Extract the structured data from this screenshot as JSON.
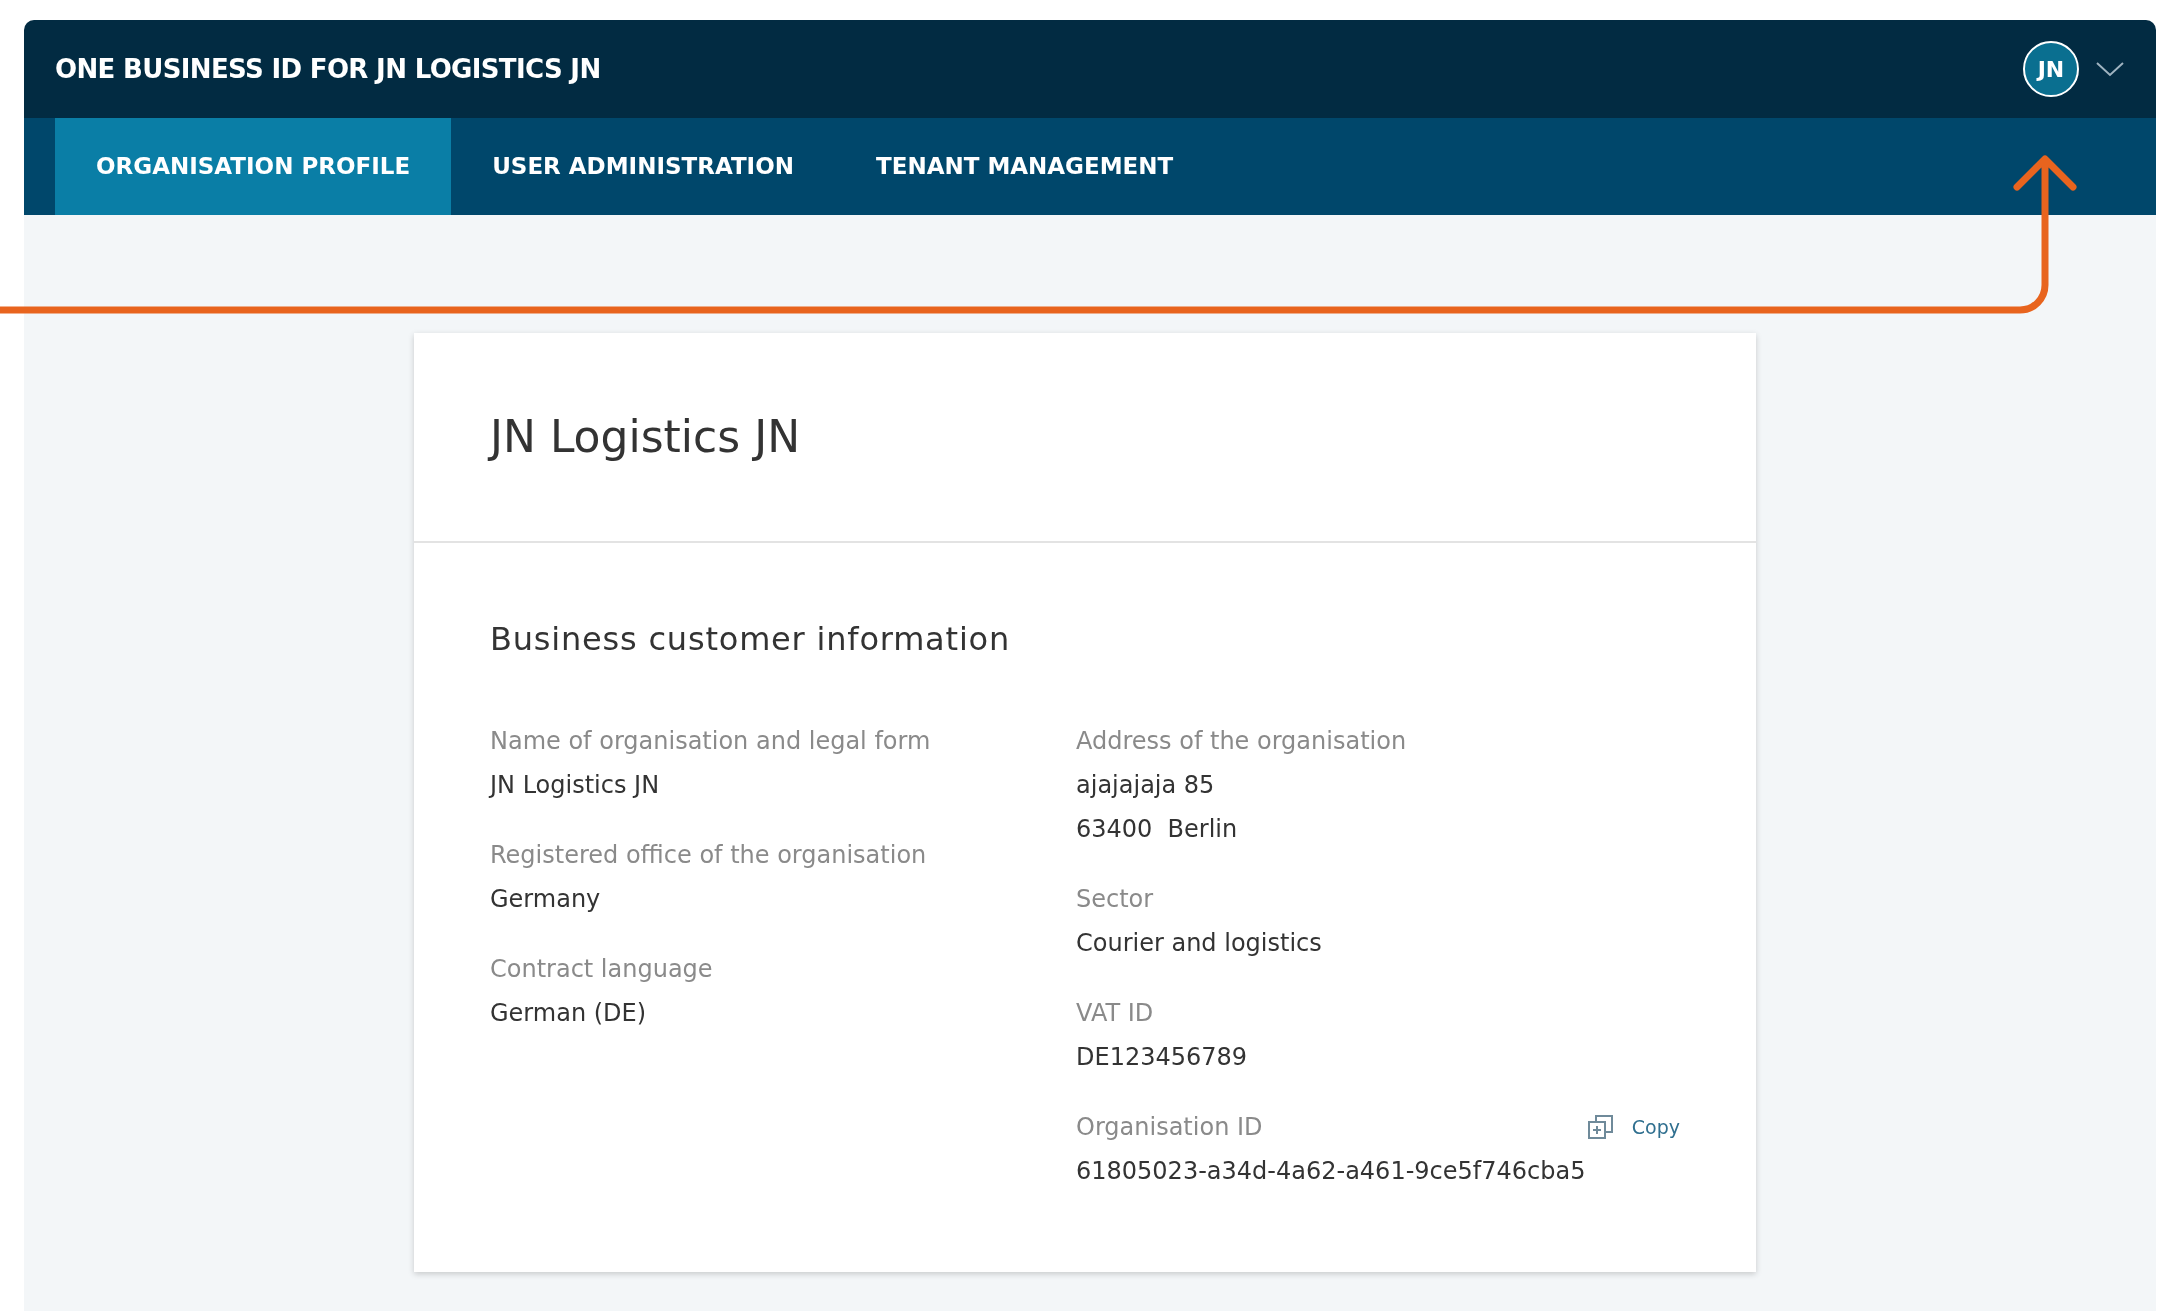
{
  "header": {
    "title": "ONE BUSINESS ID FOR JN LOGISTICS JN",
    "avatar": "JN"
  },
  "tabs": [
    {
      "label": "ORGANISATION PROFILE",
      "selected": true
    },
    {
      "label": "USER ADMINISTRATION",
      "selected": false
    },
    {
      "label": "TENANT MANAGEMENT",
      "selected": false
    }
  ],
  "card": {
    "title": "JN Logistics JN",
    "section": "Business customer information",
    "left_fields": [
      {
        "label": "Name of organisation and legal form",
        "values": [
          "JN Logistics JN"
        ]
      },
      {
        "label": "Registered office of the organisation",
        "values": [
          "Germany"
        ]
      },
      {
        "label": "Contract language",
        "values": [
          "German (DE)"
        ]
      }
    ],
    "right_fields": [
      {
        "label": "Address of the organisation",
        "values": [
          "ajajajaja 85",
          "63400  Berlin"
        ]
      },
      {
        "label": "Sector",
        "values": [
          "Courier and logistics"
        ]
      },
      {
        "label": "VAT ID",
        "values": [
          "DE123456789"
        ]
      },
      {
        "label": "Organisation ID",
        "values": [
          "61805023-a34d-4a62-a461-9ce5f746cba5"
        ],
        "action": "Copy"
      }
    ]
  }
}
